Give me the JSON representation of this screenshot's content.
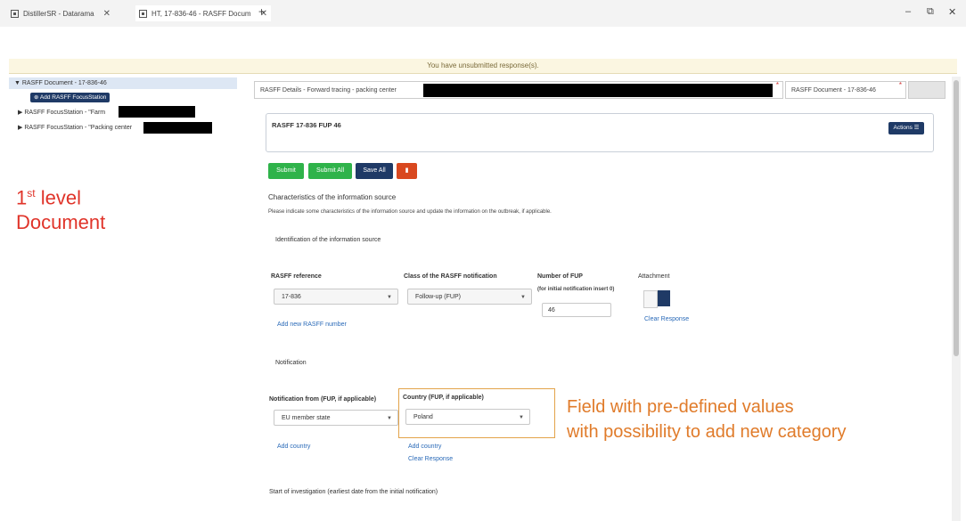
{
  "browser": {
    "tabs": [
      {
        "label": "DistillerSR - Datarama"
      },
      {
        "label": "HT, 17-836-46 - RASFF Docum"
      }
    ],
    "new_tab": "+",
    "window_controls": [
      "–",
      "⧉",
      "✕"
    ]
  },
  "notice": "You have unsubmitted response(s).",
  "tree": {
    "root": "▼  RASFF Document - 17-836-46",
    "add_button": "Add RASFF FocusStation",
    "items": [
      {
        "label": "▶  RASFF FocusStation - \"Farm"
      },
      {
        "label": "▶  RASFF FocusStation - \"Packing center"
      }
    ]
  },
  "annotations": {
    "level_prefix": "1",
    "level_sup": "st",
    "level_rest": " level",
    "level_line2": "Document",
    "field_line1": "Field with pre-defined values",
    "field_line2": "with possibility to add new category"
  },
  "doc_tabs": [
    {
      "label": "RASFF Details - Forward tracing - packing center"
    },
    {
      "label": "RASFF Document - 17-836-46"
    }
  ],
  "doc_header": {
    "title": "RASFF 17-836 FUP 46",
    "actions": "Actions ☰"
  },
  "toolbar": {
    "submit": "Submit",
    "submit_all": "Submit All",
    "save_all": "Save All",
    "delete_icon": "trash-icon",
    "colors": {
      "submit": "#2fb34a",
      "save": "#1f3a66",
      "delete": "#d9481f"
    }
  },
  "form": {
    "section_title": "Characteristics of the information source",
    "section_desc": "Please indicate some characteristics of the information source and update the information on the outbreak, if applicable.",
    "identification_title": "Identification of the information source",
    "rasff_reference_label": "RASFF reference",
    "rasff_reference_value": "17-836",
    "class_label": "Class of the RASFF notification",
    "class_value": "Follow-up (FUP)",
    "fup_label": "Number of FUP",
    "fup_sublabel": "(for initial notification insert 0)",
    "fup_value": "46",
    "attachment_label": "Attachment",
    "clear_response": "Clear Response",
    "add_rasff_number": "Add new RASFF number",
    "notification_title": "Notification",
    "notification_from_label": "Notification from (FUP, if applicable)",
    "notification_from_value": "EU member state",
    "country_label": "Country (FUP, if applicable)",
    "country_value": "Poland",
    "add_country": "Add country",
    "add_country_2": "Add country",
    "clear_response_2": "Clear Response",
    "start_investigation": "Start of investigation (earliest date from the initial notification)"
  }
}
